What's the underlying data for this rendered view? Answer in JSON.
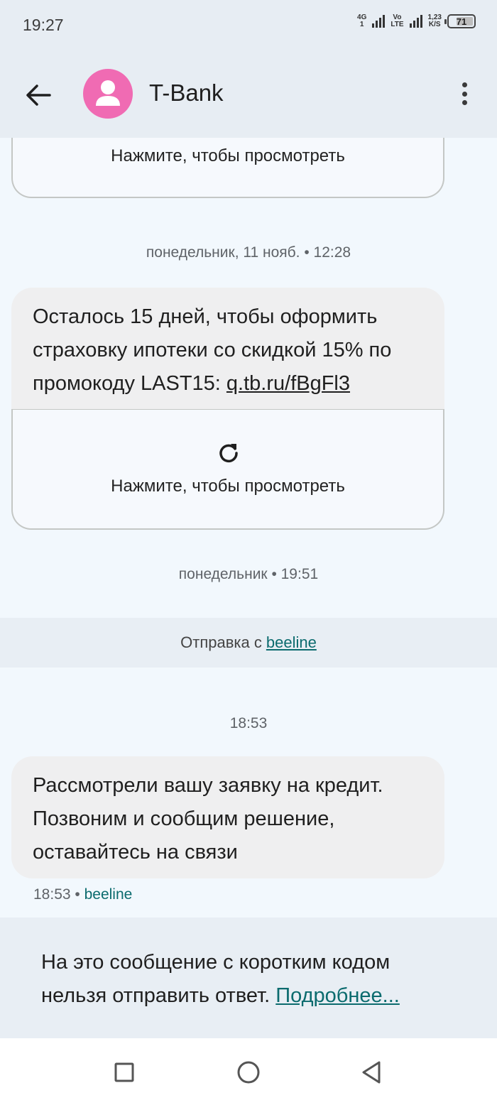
{
  "status_bar": {
    "time": "19:27",
    "network1": "4G",
    "network1_sub": "1",
    "network2": "Vo",
    "network2_sub": "LTE",
    "speed_value": "1,23",
    "speed_unit": "K/S",
    "battery_level": "71"
  },
  "header": {
    "contact_name": "T-Bank",
    "avatar_color": "#f06bb3"
  },
  "conversation": {
    "top_card_text": "Нажмите, чтобы просмотреть",
    "timestamp_1": "понедельник, 11 нояб. • 12:28",
    "message_1_text": "Осталось 15 дней, чтобы оформить страховку ипотеки со скидкой 15% по промокоду LAST15: ",
    "message_1_link": "q.tb.ru/fBgFl3",
    "message_1_card_text": "Нажмите, чтобы просмотреть",
    "timestamp_2": "понедельник • 19:51",
    "sender_prefix": "Отправка с",
    "sender_carrier": "beeline",
    "timestamp_3": "18:53",
    "message_2_text": "Рассмотрели вашу заявку на кредит. Позвоним и сообщим решение, оставайтесь на связи",
    "message_2_time": "18:53 •",
    "message_2_carrier": "beeline"
  },
  "reply_note": {
    "text": "На это сообщение с коротким кодом нельзя отправить ответ. ",
    "learn_more": "Подробнее..."
  },
  "nav_bar": {
    "recents_icon": "square-icon",
    "home_icon": "circle-icon",
    "back_icon": "triangle-back-icon"
  }
}
